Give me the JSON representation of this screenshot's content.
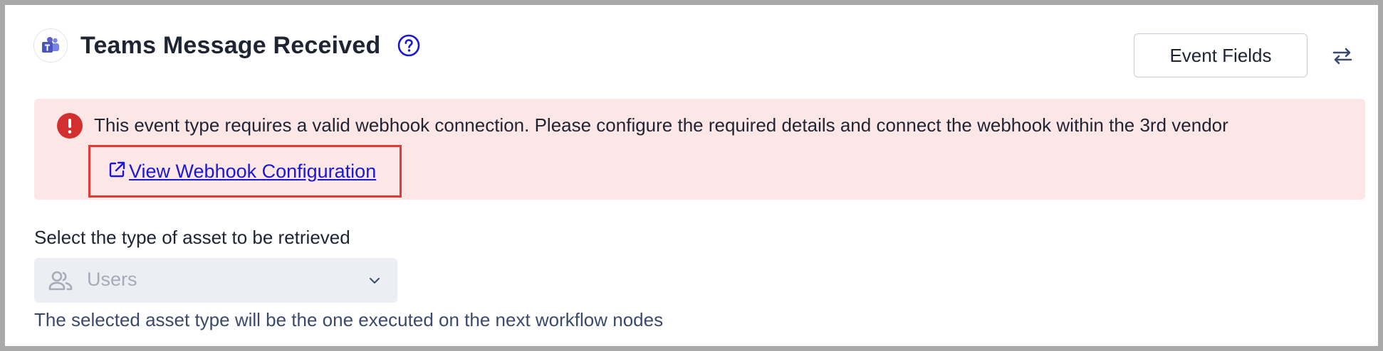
{
  "header": {
    "app_icon": "microsoft-teams-icon",
    "title": "Teams Message Received",
    "help_icon": "question-circle-icon"
  },
  "toolbar": {
    "event_fields_label": "Event Fields",
    "swap_icon": "swap-arrows-icon"
  },
  "alert": {
    "icon": "exclamation-circle-icon",
    "message": "This event type requires a valid webhook connection. Please configure the required details and connect the webhook within the 3rd vendor",
    "link_icon": "external-link-icon",
    "link_label": " View Webhook Configuration"
  },
  "asset_type": {
    "label": "Select the type of asset to be retrieved",
    "icon": "users-icon",
    "selected_value": "Users",
    "dropdown_icon": "chevron-down-icon",
    "helper_text": "The selected asset type will be the one executed on the next workflow nodes"
  },
  "colors": {
    "alert_background": "#fde6e6",
    "alert_icon": "#d32f2f",
    "link": "#1a18d6",
    "help_icon": "#1a18d6",
    "highlight_border": "#e53935",
    "teams_purple": "#5b5fc7"
  }
}
